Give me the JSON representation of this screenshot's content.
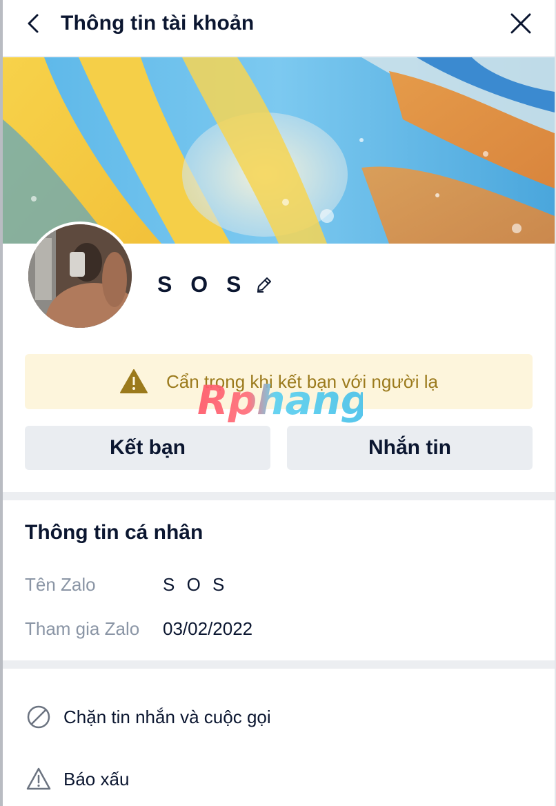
{
  "header": {
    "title": "Thông tin tài khoản",
    "back_icon": "chevron-left-icon",
    "close_icon": "close-icon"
  },
  "profile": {
    "name": "S O S",
    "edit_icon": "pencil-icon"
  },
  "warning": {
    "text": "Cẩn trọng khi kết bạn với người lạ",
    "icon": "warning-triangle-icon",
    "bg_color": "#fdf5dc",
    "text_color": "#9b7a1c"
  },
  "watermark": {
    "text": "Rphang"
  },
  "buttons": {
    "add_friend": "Kết bạn",
    "message": "Nhắn tin"
  },
  "personal_info": {
    "title": "Thông tin cá nhân",
    "rows": [
      {
        "label": "Tên Zalo",
        "value": "S O S"
      },
      {
        "label": "Tham gia Zalo",
        "value": "03/02/2022"
      }
    ]
  },
  "actions": [
    {
      "label": "Chặn tin nhắn và cuộc gọi",
      "icon": "block-icon"
    },
    {
      "label": "Báo xấu",
      "icon": "warning-icon"
    }
  ]
}
